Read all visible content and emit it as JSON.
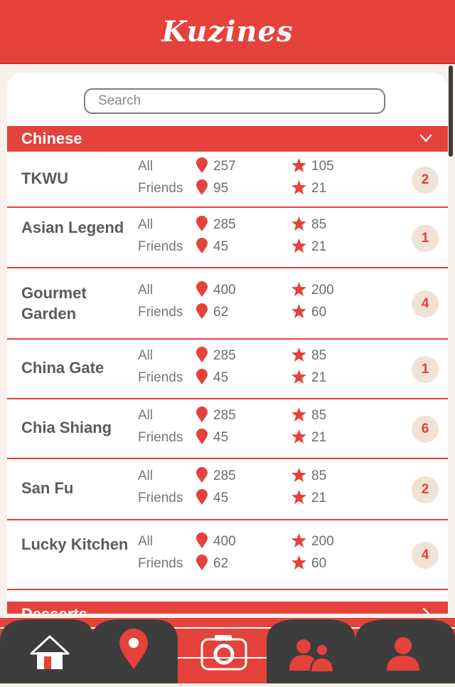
{
  "app": {
    "title": "Kuzines"
  },
  "search": {
    "placeholder": "Search"
  },
  "stats_labels": {
    "all": "All",
    "friends": "Friends"
  },
  "categories": [
    {
      "label": "Chinese",
      "state": "expanded",
      "icon": "chevron-down-icon"
    },
    {
      "label": "Desserts",
      "state": "collapsed",
      "icon": "chevron-right-icon"
    }
  ],
  "restaurants": [
    {
      "name": "TKWU",
      "all_checkins": "257",
      "all_rating": "105",
      "friends_checkins": "95",
      "friends_rating": "21",
      "badge": "2"
    },
    {
      "name": "Asian Legend",
      "all_checkins": "285",
      "all_rating": "85",
      "friends_checkins": "45",
      "friends_rating": "21",
      "badge": "1"
    },
    {
      "name": "Gourmet Garden",
      "all_checkins": "400",
      "all_rating": "200",
      "friends_checkins": "62",
      "friends_rating": "60",
      "badge": "4"
    },
    {
      "name": "China Gate",
      "all_checkins": "285",
      "all_rating": "85",
      "friends_checkins": "45",
      "friends_rating": "21",
      "badge": "1"
    },
    {
      "name": "Chia Shiang",
      "all_checkins": "285",
      "all_rating": "85",
      "friends_checkins": "45",
      "friends_rating": "21",
      "badge": "6"
    },
    {
      "name": "San Fu",
      "all_checkins": "285",
      "all_rating": "85",
      "friends_checkins": "45",
      "friends_rating": "21",
      "badge": "2"
    },
    {
      "name": "Lucky Kitchen",
      "all_checkins": "400",
      "all_rating": "200",
      "friends_checkins": "62",
      "friends_rating": "60",
      "badge": "4"
    }
  ],
  "tabs": [
    {
      "id": "home",
      "icon": "home-icon"
    },
    {
      "id": "places",
      "icon": "map-pin-icon"
    },
    {
      "id": "camera",
      "icon": "camera-icon",
      "state": "active"
    },
    {
      "id": "friends",
      "icon": "friends-icon"
    },
    {
      "id": "profile",
      "icon": "user-icon"
    }
  ],
  "colors": {
    "accent": "#e4423a",
    "tab_dark": "#3d3d3d",
    "badge_bg": "#f0e3d6",
    "page_bg": "#f6f1ea"
  }
}
